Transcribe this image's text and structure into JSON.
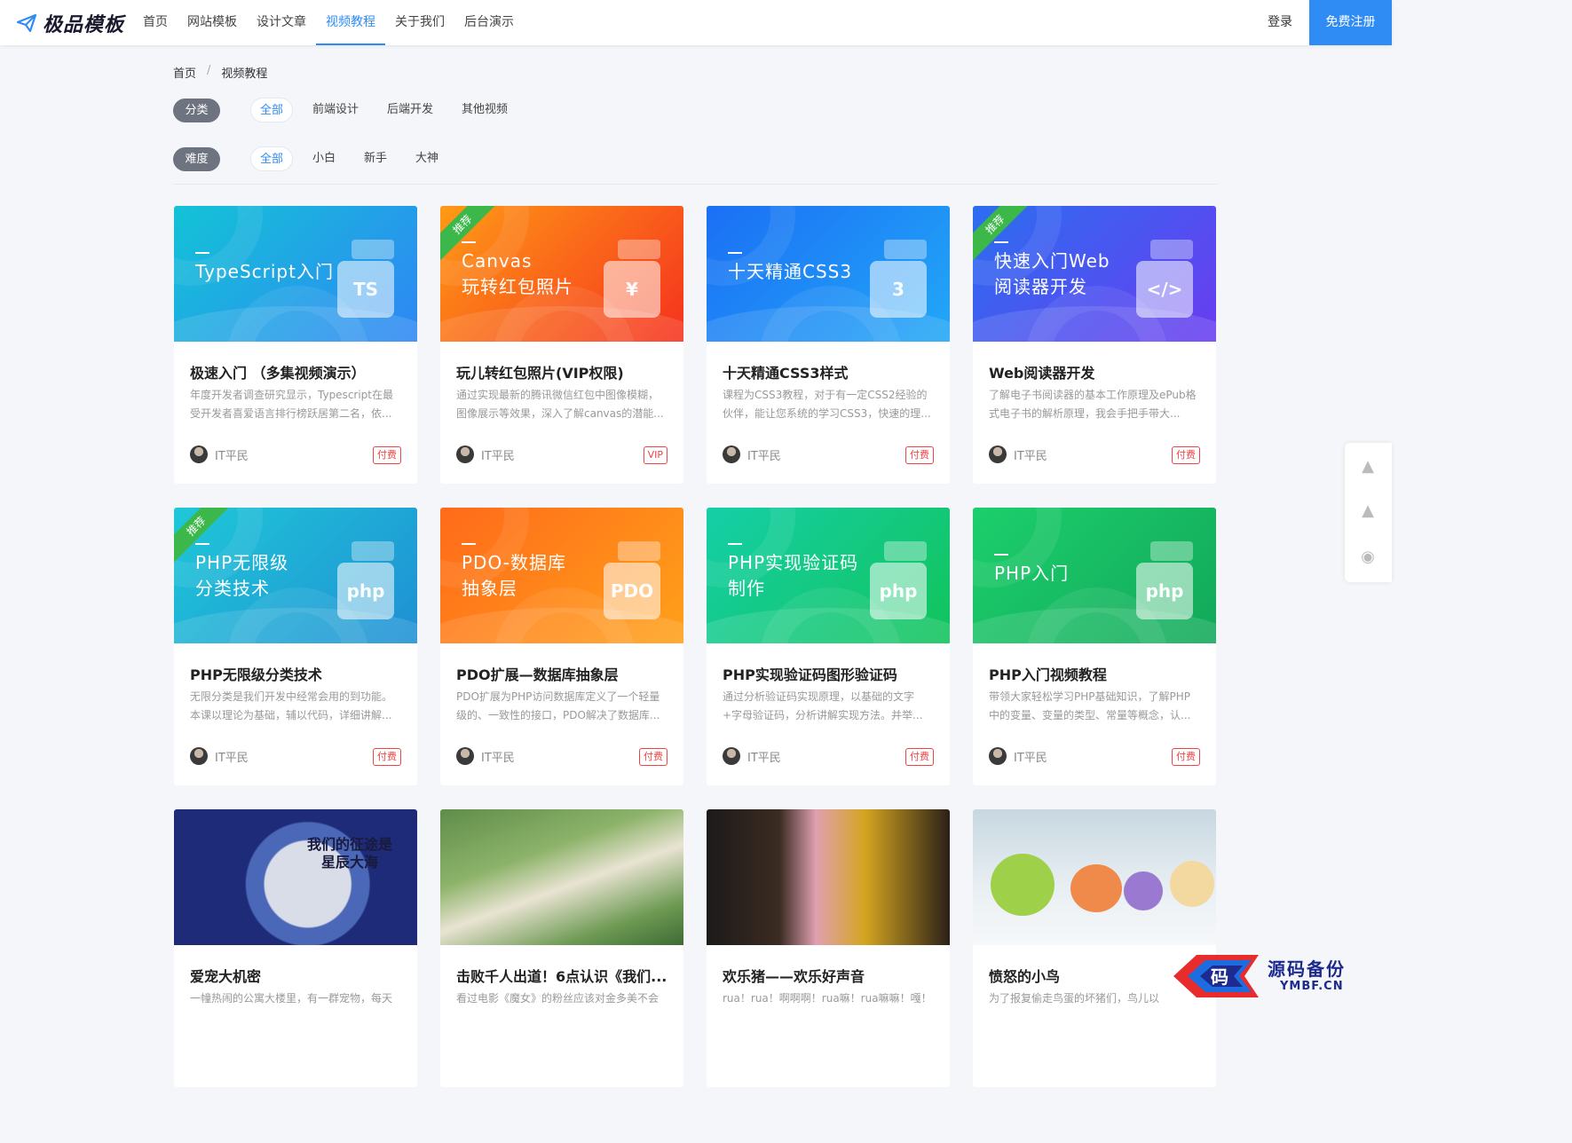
{
  "header": {
    "logo_text": "极品模板",
    "nav": [
      "首页",
      "网站模板",
      "设计文章",
      "视频教程",
      "关于我们",
      "后台演示"
    ],
    "login": "登录",
    "register": "免费注册"
  },
  "breadcrumb": {
    "home": "首页",
    "sep": "/",
    "current": "视频教程"
  },
  "filters": {
    "category": {
      "label": "分类",
      "options": [
        "全部",
        "前端设计",
        "后端开发",
        "其他视频"
      ]
    },
    "difficulty": {
      "label": "难度",
      "options": [
        "全部",
        "小白",
        "新手",
        "大神"
      ]
    }
  },
  "ribbon": "推荐",
  "author": "IT平民",
  "cards": [
    {
      "thumb_lines": [
        "TypeScript入门"
      ],
      "icon": "TS",
      "title": "极速入门 （多集视频演示）",
      "desc": "年度开发者调查研究显示，Typescript在最受开发者喜爱语言排行榜跃居第二名，依...",
      "badge": "付费",
      "recommended": false,
      "colors": [
        "#13c3d6",
        "#2f86f4"
      ]
    },
    {
      "thumb_lines": [
        "Canvas",
        "玩转红包照片"
      ],
      "icon": "¥",
      "title": "玩儿转红包照片(VIP权限)",
      "desc": "通过实现最新的腾讯微信红包中图像模糊，图像展示等效果，深入了解canvas的潜能...",
      "badge": "VIP",
      "recommended": true,
      "colors": [
        "#ff9a16",
        "#f5321e"
      ]
    },
    {
      "thumb_lines": [
        "十天精通CSS3"
      ],
      "icon": "3",
      "title": "十天精通CSS3样式",
      "desc": "课程为CSS3教程，对于有一定CSS2经验的伙伴，能让您系统的学习CSS3，快速的理...",
      "badge": "付费",
      "recommended": false,
      "colors": [
        "#1b6ff5",
        "#22a8f6"
      ]
    },
    {
      "thumb_lines": [
        "快速入门Web",
        "阅读器开发"
      ],
      "icon": "</>",
      "title": "Web阅读器开发",
      "desc": "了解电子书阅读器的基本工作原理及ePub格式电子书的解析原理，我会手把手带大...",
      "badge": "付费",
      "recommended": true,
      "colors": [
        "#2b6ef0",
        "#6a3cf0"
      ]
    },
    {
      "thumb_lines": [
        "PHP无限级",
        "分类技术"
      ],
      "icon": "php",
      "title": "PHP无限级分类技术",
      "desc": "无限分类是我们开发中经常会用的到功能。本课以理论为基础，辅以代码，详细讲解...",
      "badge": "付费",
      "recommended": true,
      "colors": [
        "#1fc8d8",
        "#1f8fd4"
      ]
    },
    {
      "thumb_lines": [
        "PDO-数据库",
        "抽象层"
      ],
      "icon": "PDO",
      "title": "PDO扩展—数据库抽象层",
      "desc": "PDO扩展为PHP访问数据库定义了一个轻量级的、一致性的接口，PDO解决了数据库...",
      "badge": "付费",
      "recommended": false,
      "colors": [
        "#ff6a1a",
        "#ffa11a"
      ]
    },
    {
      "thumb_lines": [
        "PHP实现验证码",
        "制作"
      ],
      "icon": "php",
      "title": "PHP实现验证码图形验证码",
      "desc": "通过分析验证码实现原理，以基础的文字+字母验证码，分析讲解实现方法。并举...",
      "badge": "付费",
      "recommended": false,
      "colors": [
        "#15cfa8",
        "#12c35a"
      ]
    },
    {
      "thumb_lines": [
        "PHP入门"
      ],
      "icon": "php",
      "title": "PHP入门视频教程",
      "desc": "带领大家轻松学习PHP基础知识，了解PHP中的变量、变量的类型、常量等概念，认...",
      "badge": "付费",
      "recommended": false,
      "colors": [
        "#1ccf6c",
        "#12a85a"
      ]
    }
  ],
  "photo_cards": [
    {
      "title": "爱宠大机密",
      "desc": "一幢热闹的公寓大楼里，有一群宠物，每天",
      "caption": [
        "我们的征途是",
        "星辰大海"
      ]
    },
    {
      "title": "击败千人出道！6点认识《我们...",
      "desc": "看过电影《魔女》的粉丝应该对金多美不会"
    },
    {
      "title": "欢乐猪——欢乐好声音",
      "desc": "rua！rua！啊啊啊！rua嘛！rua嘛嘛！嘎！"
    },
    {
      "title": "愤怒的小鸟",
      "desc": "为了报复偷走鸟蛋的坏猪们，鸟儿以"
    }
  ],
  "watermark": {
    "text1": "源码备份",
    "text2": "YMBF.CN",
    "glyph": "码"
  }
}
